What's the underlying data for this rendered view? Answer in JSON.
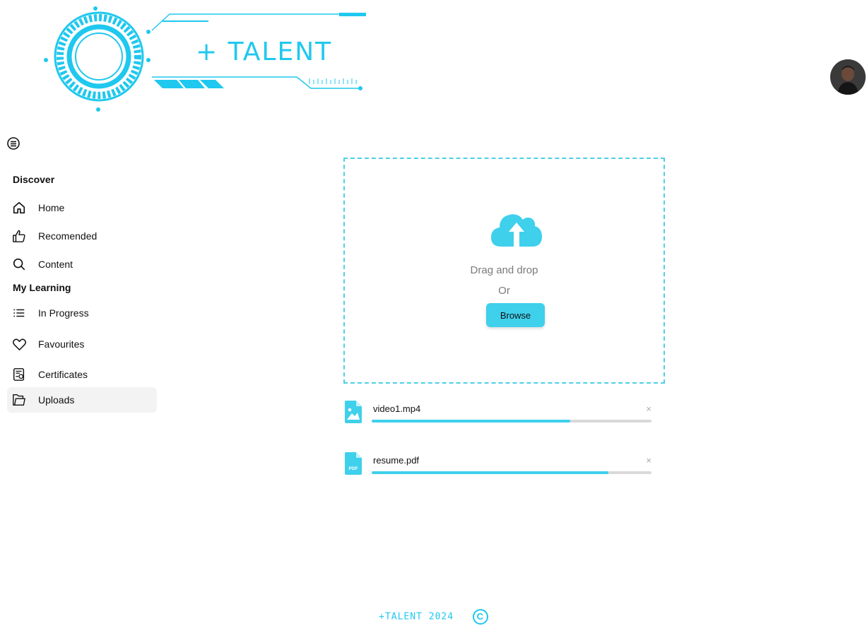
{
  "brand": {
    "logo_text": "+ TALENT",
    "accent_color": "#1fc8ee"
  },
  "user": {
    "avatar_icon": "avatar"
  },
  "sidebar": {
    "menu_icon": "menu-icon",
    "sections": [
      {
        "title": "Discover",
        "items": [
          {
            "label": "Home",
            "icon": "home-icon"
          },
          {
            "label": "Recomended",
            "icon": "thumbs-up-icon"
          },
          {
            "label": "Content",
            "icon": "search-icon"
          }
        ]
      },
      {
        "title": "My Learning",
        "items": [
          {
            "label": "In Progress",
            "icon": "list-icon"
          },
          {
            "label": "Favourites",
            "icon": "heart-icon"
          },
          {
            "label": "Certificates",
            "icon": "certificate-icon"
          },
          {
            "label": "Uploads",
            "icon": "folder-icon",
            "active": true
          }
        ]
      }
    ]
  },
  "upload": {
    "drag_text": "Drag and drop",
    "or_text": "Or",
    "browse_label": "Browse",
    "icon": "cloud-upload-icon"
  },
  "files": [
    {
      "name": "video1.mp4",
      "icon": "image-file-icon",
      "progress": 0.71,
      "close": "×"
    },
    {
      "name": "resume.pdf",
      "icon": "pdf-file-icon",
      "progress": 0.845,
      "close": "×"
    }
  ],
  "footer": {
    "text": "+TALENT 2024",
    "copyright_symbol": "C"
  }
}
